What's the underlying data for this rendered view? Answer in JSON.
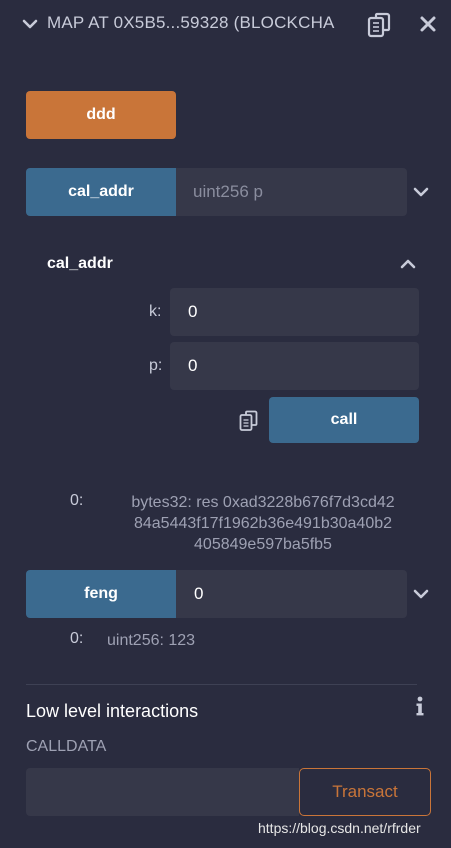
{
  "header": {
    "title": "MAP AT 0X5B5...59328 (BLOCKCHA",
    "icons": [
      "chevron-down-icon",
      "copy-icon",
      "close-icon"
    ]
  },
  "buttons": {
    "ddd": "ddd",
    "cal_addr": "cal_addr",
    "call": "call",
    "feng": "feng",
    "transact": "Transact"
  },
  "cal_addr_input": {
    "placeholder": "uint256 p"
  },
  "cal_addr_expanded": {
    "title": "cal_addr",
    "params": [
      {
        "label": "k:",
        "value": "0"
      },
      {
        "label": "p:",
        "value": "0"
      }
    ]
  },
  "cal_addr_output": {
    "index": "0:",
    "text": "bytes32: res 0xad3228b676f7d3cd4284a5443f17f1962b36e491b30a40b2405849e597ba5fb5",
    "lines": [
      "bytes32: res 0xad3228b676f7d3cd42",
      "84a5443f17f1962b36e491b30a40b2",
      "405849e597ba5fb5"
    ]
  },
  "feng_input": {
    "value": "0"
  },
  "feng_output": {
    "index": "0:",
    "text": "uint256: 123"
  },
  "low_level": {
    "title": "Low level interactions",
    "calldata_label": "CALLDATA"
  },
  "watermark": "https://blog.csdn.net/rfrder",
  "colors": {
    "background": "#2a2c3f",
    "orange": "#c97539",
    "blue": "#3b6a8f",
    "input": "#363849"
  }
}
